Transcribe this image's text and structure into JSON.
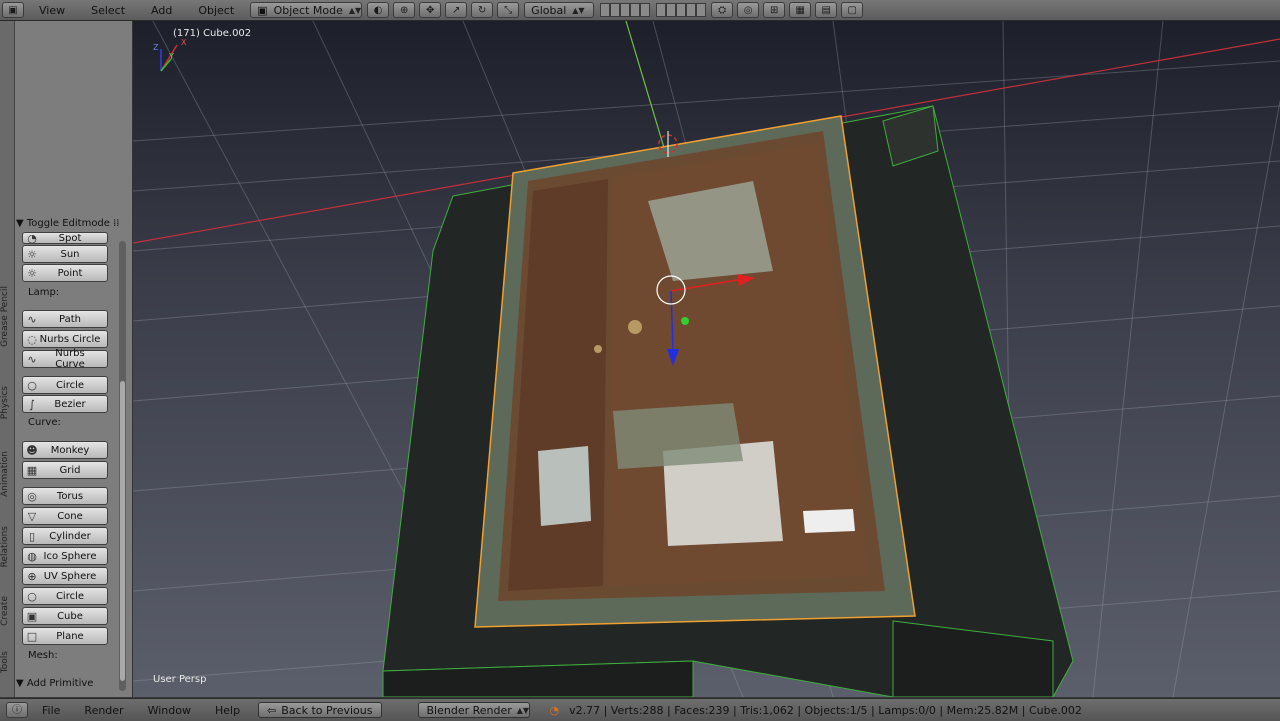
{
  "header": {
    "menus": [
      "View",
      "Select",
      "Add",
      "Object"
    ],
    "mode": "Object Mode",
    "orientation": "Global"
  },
  "toolbar": {
    "tabs": [
      "Tools",
      "Create",
      "Relations",
      "Animation",
      "Physics",
      "Grease Pencil"
    ],
    "toggle_editmode": "Toggle Editmode",
    "add_primitive": "Add Primitive",
    "mesh_label": "Mesh:",
    "mesh_items": [
      "Plane",
      "Cube",
      "Circle",
      "UV Sphere",
      "Ico Sphere",
      "Cylinder",
      "Cone",
      "Torus",
      "Grid",
      "Monkey"
    ],
    "curve_label": "Curve:",
    "curve_items": [
      "Bezier",
      "Circle",
      "Nurbs Curve",
      "Nurbs Circle",
      "Path"
    ],
    "lamp_label": "Lamp:",
    "lamp_items": [
      "Point",
      "Sun",
      "Spot"
    ]
  },
  "viewport": {
    "object_label": "(171) Cube.002",
    "view_label": "User Persp",
    "axis_x": "X",
    "axis_y": "Y",
    "axis_z": "Z"
  },
  "footer": {
    "menus": [
      "File",
      "Render",
      "Window",
      "Help"
    ],
    "back_button": "Back to Previous",
    "engine": "Blender Render",
    "stats": "v2.77 | Verts:288 | Faces:239 | Tris:1,062 | Objects:1/5 | Lamps:0/0 | Mem:25.82M | Cube.002"
  },
  "colors": {
    "viewport_top": "#1d1f2a",
    "viewport_bottom": "#5b5f6b",
    "x_axis": "#c0303a",
    "y_axis": "#6fbf40",
    "selection": "#f0a030",
    "wire": "#3fae3f"
  }
}
